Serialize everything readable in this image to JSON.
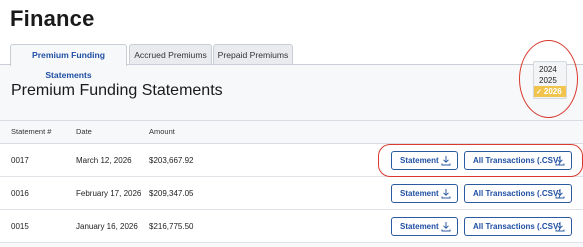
{
  "page": {
    "title": "Finance"
  },
  "tabs": [
    {
      "label": "Premium Funding Statements",
      "active": true
    },
    {
      "label": "Accrued Premiums",
      "active": false
    },
    {
      "label": "Prepaid Premiums",
      "active": false
    }
  ],
  "section": {
    "title": "Premium Funding Statements"
  },
  "year_select": {
    "options": [
      "2024",
      "2025",
      "2026"
    ],
    "selected": "2026",
    "check_glyph": "✓"
  },
  "table": {
    "columns": [
      "Statement #",
      "Date",
      "Amount"
    ],
    "rows": [
      {
        "number": "0017",
        "date": "March 12, 2026",
        "amount": "$203,667.92"
      },
      {
        "number": "0016",
        "date": "February 17, 2026",
        "amount": "$209,347.05"
      },
      {
        "number": "0015",
        "date": "January 16, 2026",
        "amount": "$216,775.50"
      }
    ],
    "statement_button_label": "Statement",
    "csv_button_label": "All Transactions (.CSV)"
  },
  "colors": {
    "accent_blue": "#1f4fa3",
    "highlight_yellow": "#f0c44d",
    "annotation_red": "#d9392f"
  },
  "icons": {
    "download": "download-icon",
    "check": "check-icon"
  }
}
